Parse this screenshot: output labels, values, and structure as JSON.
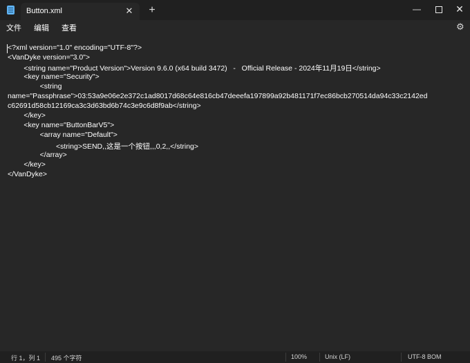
{
  "window": {
    "tab_title": "Button.xml",
    "tab_close_glyph": "✕",
    "new_tab_glyph": "+",
    "minimize_glyph": "—",
    "close_glyph": "✕"
  },
  "menu": {
    "file": "文件",
    "edit": "编辑",
    "view": "查看",
    "settings_glyph": "⚙"
  },
  "editor": {
    "lines": [
      "<?xml version=\"1.0\" encoding=\"UTF-8\"?>",
      "<VanDyke version=\"3.0\">",
      "        <string name=\"Product Version\">Version 9.6.0 (x64 build 3472)   -   Official Release - 2024年11月19日</string>",
      "        <key name=\"Security\">",
      "                <string",
      "name=\"Passphrase\">03:53a9e06e2e372c1ad8017d68c64e816cb47deeefa197899a92b481171f7ec86bcb270514da94c33c2142ed",
      "c62691d58cb12169ca3c3d63bd6b74c3e9c6d8f9ab</string>",
      "        </key>",
      "        <key name=\"ButtonBarV5\">",
      "                <array name=\"Default\">",
      "                        <string>SEND,,这是一个按钮,,,0,2,,</string>",
      "                </array>",
      "        </key>",
      "</VanDyke>"
    ]
  },
  "status": {
    "position": "行 1，列 1",
    "char_count": "495 个字符",
    "zoom": "100%",
    "line_ending": "Unix (LF)",
    "encoding": "UTF-8 BOM"
  },
  "colors": {
    "background": "#272727",
    "chrome": "#202020",
    "text": "#ffffff",
    "icon_accent": "#5fb2f2"
  }
}
